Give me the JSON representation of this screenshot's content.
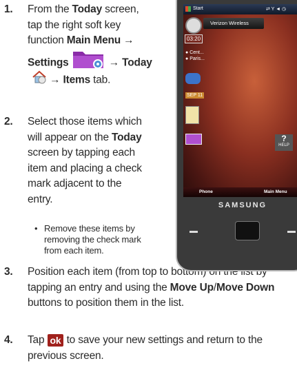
{
  "steps": [
    {
      "number": "1.",
      "lines": [
        {
          "pre": "From the ",
          "bold": "Today",
          "post": " screen,"
        },
        {
          "pre": "tap the right soft key"
        },
        {
          "pre": "function ",
          "bold": "Main Menu →"
        },
        {
          "bold": "Settings",
          "post2": "→ Today"
        },
        {
          "bold2": "→ Items",
          "post": " tab."
        }
      ]
    },
    {
      "number": "2.",
      "lines": [
        {
          "pre": "Select those items which"
        },
        {
          "pre": "will appear on the ",
          "bold": "Today"
        },
        {
          "pre": "screen by tapping each"
        },
        {
          "pre": "item and placing a check"
        },
        {
          "pre": "mark adjacent to the"
        },
        {
          "pre": "entry."
        }
      ],
      "bullet": {
        "dot": "•",
        "lines": [
          "Remove these items by",
          "removing the check mark",
          "from each item."
        ]
      }
    },
    {
      "number": "3.",
      "lines": [
        {
          "pre": "Position each item (from top to bottom) on the list by"
        },
        {
          "pre": "tapping an entry and using the ",
          "bold": "Move Up",
          "mid": "/",
          "bold3": "Move Down"
        },
        {
          "pre": "buttons to position them in the list."
        }
      ]
    },
    {
      "number": "4.",
      "lines": [
        {
          "pre": "Tap ",
          "icon": "ok",
          "post": " to save your new settings and return to the"
        },
        {
          "pre": "previous screen."
        }
      ]
    }
  ],
  "phone": {
    "status_start": "Start",
    "carrier": "Verizon Wireless",
    "time": "03:20",
    "cal_item1": "Cent...",
    "cal_item2": "Paris...",
    "date": "SEP 11",
    "help": "HELP",
    "help_q": "?",
    "softkey_left": "Phone",
    "softkey_right": "Main Menu",
    "brand": "SAMSUNG"
  },
  "icons": [
    "settings-folder-icon",
    "today-house-icon",
    "ok-button-icon"
  ],
  "colors": {
    "ok_button": "#a0211c",
    "text": "#2b2b2b"
  }
}
